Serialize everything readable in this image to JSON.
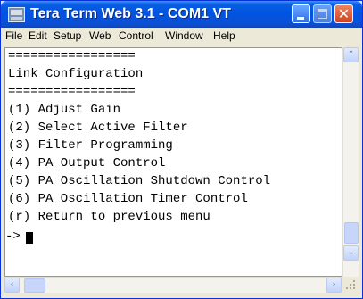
{
  "window": {
    "title": "Tera Term Web 3.1 - COM1 VT",
    "icon": "teraterm-app-icon",
    "controls": {
      "minimize_icon": "minimize-icon",
      "maximize_icon": "maximize-icon",
      "close_icon": "close-icon",
      "close_glyph": "✕"
    }
  },
  "menu": {
    "items": [
      "File",
      "Edit",
      "Setup",
      "Web",
      "Control",
      "Window",
      "Help"
    ]
  },
  "terminal": {
    "lines": [
      "=================",
      "Link Configuration",
      "=================",
      "(1) Adjust Gain",
      "(2) Select Active Filter",
      "(3) Filter Programming",
      "(4) PA Output Control",
      "(5) PA Oscillation Shutdown Control",
      "(6) PA Oscillation Timer Control",
      "(r) Return to previous menu",
      "->"
    ]
  },
  "scrollbars": {
    "up_glyph": "⌃",
    "down_glyph": "⌄",
    "left_glyph": "‹",
    "right_glyph": "›"
  },
  "colors": {
    "titlebar": "#0054e3",
    "window_frame": "#ece9d8",
    "terminal_bg": "#ffffff",
    "terminal_text": "#000000",
    "close_button": "#d0421f"
  }
}
